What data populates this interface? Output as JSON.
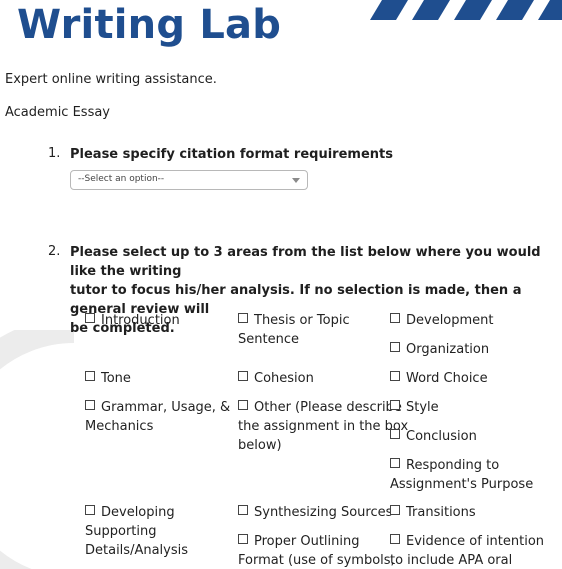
{
  "header": {
    "title": "Writing Lab",
    "subtitle": "Expert online writing assistance.",
    "doc_type": "Academic Essay",
    "accent_color": "#1f4e8f"
  },
  "question1": {
    "number": "1.",
    "text": "Please specify citation format requirements",
    "select_value": "--Select an option--"
  },
  "question2": {
    "number": "2.",
    "text_lines": [
      "Please select up to 3 areas from the list below where you would like the writing",
      "tutor to focus his/her analysis. If no selection is made, then a general review will",
      "be completed."
    ],
    "options": {
      "introduction": "Introduction",
      "thesis": [
        "Thesis or Topic",
        "Sentence"
      ],
      "development": "Development",
      "organization": "Organization",
      "tone": "Tone",
      "cohesion": "Cohesion",
      "word_choice": "Word Choice",
      "grammar": [
        "Grammar, Usage, &",
        "Mechanics"
      ],
      "other": [
        "Other (Please describe",
        "the assignment in the box",
        "below)"
      ],
      "style": "Style",
      "conclusion": "Conclusion",
      "responding": [
        "Responding to",
        "Assignment's Purpose"
      ],
      "developing": [
        "Developing",
        "Supporting",
        "Details/Analysis"
      ],
      "synthesizing": "Synthesizing Sources",
      "transitions": "Transitions",
      "proper_outlining": [
        "Proper Outlining",
        "Format (use of symbols,"
      ],
      "evidence": [
        "Evidence of intention",
        "to include APA oral"
      ]
    }
  }
}
